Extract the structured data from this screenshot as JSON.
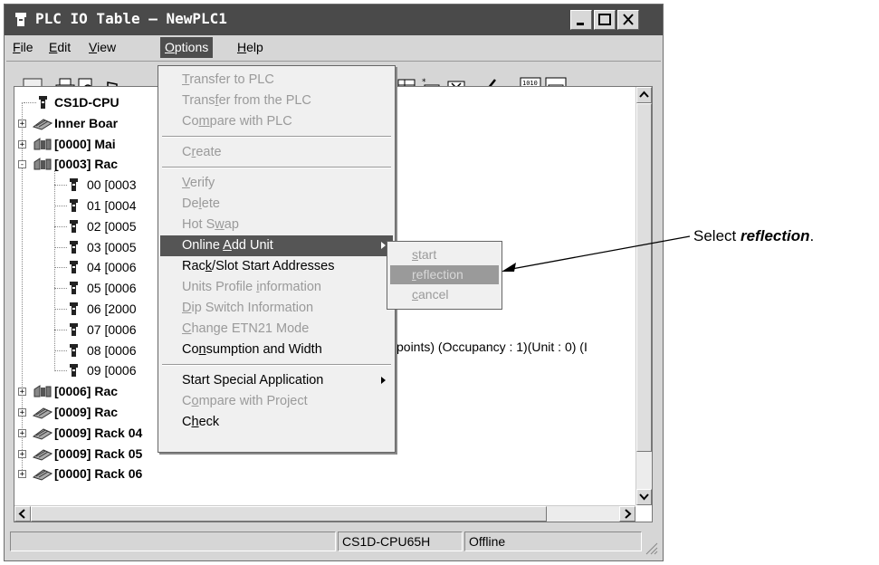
{
  "window": {
    "title": "PLC IO Table – NewPLC1"
  },
  "menubar": [
    {
      "label": "File",
      "ul": "F",
      "rest": "ile"
    },
    {
      "label": "Edit",
      "ul": "E",
      "rest": "dit"
    },
    {
      "label": "View",
      "ul": "V",
      "rest": "iew"
    },
    {
      "label": "Options",
      "ul": "O",
      "rest": "ptions"
    },
    {
      "label": "Help",
      "ul": "H",
      "rest": "elp"
    }
  ],
  "toolbar_icons": [
    "fcps-icon",
    "print-icon",
    "print-preview-icon",
    "pin-icon",
    "io-table-icon",
    "transfer-unit-icon",
    "delete-unit-icon",
    "check-icon",
    "io-compare-icon",
    "io-unit-icon"
  ],
  "tree": {
    "rows": [
      {
        "kind": "cpu",
        "text": "CS1D-CPU",
        "bold": true
      },
      {
        "kind": "rack",
        "text": "Inner Boar",
        "bold": true,
        "exp": "+"
      },
      {
        "kind": "rack2",
        "text": "[0000] Mai",
        "bold": true,
        "exp": "+"
      },
      {
        "kind": "rack2",
        "text": "[0003] Rac",
        "bold": true,
        "exp": "−"
      },
      {
        "kind": "unit",
        "text": "00 [0003"
      },
      {
        "kind": "unit",
        "text": "01 [0004"
      },
      {
        "kind": "unit",
        "text": "02 [0005"
      },
      {
        "kind": "unit",
        "text": "03 [0005"
      },
      {
        "kind": "unit",
        "text": "04 [0006"
      },
      {
        "kind": "unit",
        "text": "05 [0006"
      },
      {
        "kind": "unit",
        "text": "06 [2000"
      },
      {
        "kind": "unit",
        "text": "07 [0006"
      },
      {
        "kind": "unit",
        "text": "08 [0006"
      },
      {
        "kind": "unit",
        "text": "09 [0006"
      },
      {
        "kind": "rack2",
        "text": "[0006] Rac",
        "bold": true,
        "exp": "+"
      },
      {
        "kind": "rack",
        "text": "[0009] Rac",
        "bold": true,
        "exp": "+"
      },
      {
        "kind": "rack",
        "text": "[0009] Rack 04",
        "bold": true,
        "exp": "+"
      },
      {
        "kind": "rack",
        "text": "[0009] Rack 05",
        "bold": true,
        "exp": "+"
      },
      {
        "kind": "rack",
        "text": "[0000] Rack 06",
        "bold": true,
        "exp": "+"
      }
    ],
    "row06_tail": "points) (Occupancy : 1)(Unit : 0) (I"
  },
  "statusbar": {
    "model": "CS1D-CPU65H",
    "mode": "Offline"
  },
  "options_menu": {
    "items": [
      {
        "pre": "",
        "ul": "T",
        "post": "ransfer to PLC",
        "disabled": true
      },
      {
        "pre": "Trans",
        "ul": "f",
        "post": "er from the PLC",
        "disabled": true
      },
      {
        "pre": "Co",
        "ul": "m",
        "post": "pare with PLC",
        "disabled": true
      },
      {
        "sep": true
      },
      {
        "pre": "C",
        "ul": "r",
        "post": "eate",
        "disabled": true
      },
      {
        "sep": true
      },
      {
        "pre": "",
        "ul": "V",
        "post": "erify",
        "disabled": true
      },
      {
        "pre": "De",
        "ul": "l",
        "post": "ete",
        "disabled": true
      },
      {
        "pre": "Hot S",
        "ul": "w",
        "post": "ap",
        "disabled": true
      },
      {
        "pre": "Online ",
        "ul": "A",
        "post": "dd Unit",
        "disabled": false,
        "selected": true,
        "submenu": true
      },
      {
        "pre": "Rac",
        "ul": "k",
        "post": "/Slot Start Addresses",
        "disabled": false
      },
      {
        "pre": "Units Profile ",
        "ul": "i",
        "post": "nformation",
        "disabled": true
      },
      {
        "pre": "",
        "ul": "D",
        "post": "ip Switch Information",
        "disabled": true
      },
      {
        "pre": "",
        "ul": "C",
        "post": "hange ETN21 Mode",
        "disabled": true
      },
      {
        "pre": "Co",
        "ul": "n",
        "post": "sumption and Width",
        "disabled": false
      },
      {
        "sep": true
      },
      {
        "pre": "Start Special Application",
        "ul": "",
        "post": "",
        "disabled": false,
        "submenu": true
      },
      {
        "pre": "C",
        "ul": "o",
        "post": "mpare with Project",
        "disabled": true
      },
      {
        "pre": "C",
        "ul": "h",
        "post": "eck",
        "disabled": false
      }
    ]
  },
  "submenu": [
    {
      "ul": "s",
      "post": "tart",
      "selected": false
    },
    {
      "ul": "r",
      "post": "eflection",
      "selected": true
    },
    {
      "ul": "c",
      "post": "ancel",
      "selected": false
    }
  ],
  "annotation": {
    "prefix": "Select ",
    "emph": "reflection",
    "suffix": "."
  }
}
